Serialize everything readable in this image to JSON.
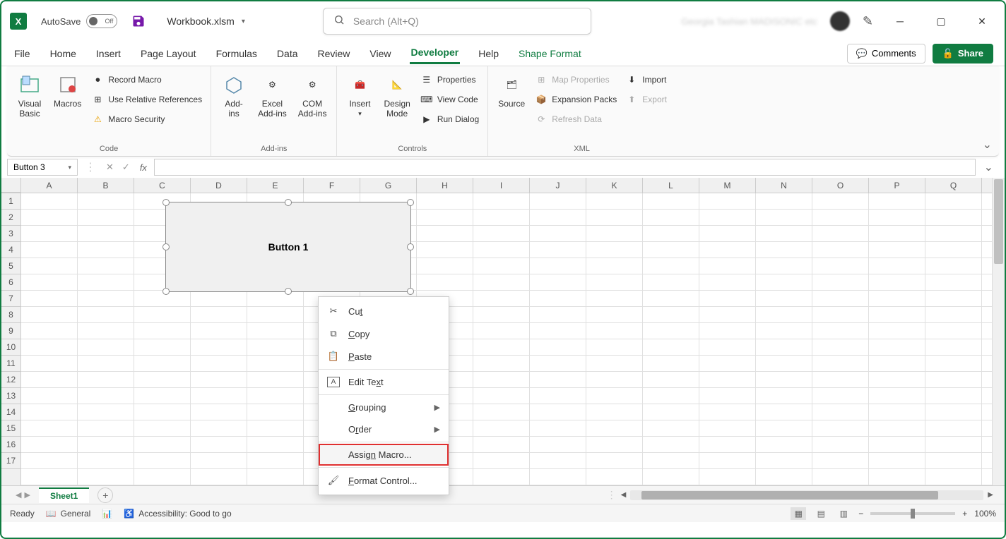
{
  "title": {
    "autosave": "AutoSave",
    "autosave_state": "Off",
    "filename": "Workbook.xlsm",
    "search_placeholder": "Search (Alt+Q)",
    "user_blurred": "Georgia Tashian MADISONIC etc"
  },
  "tabs": [
    "File",
    "Home",
    "Insert",
    "Page Layout",
    "Formulas",
    "Data",
    "Review",
    "View",
    "Developer",
    "Help",
    "Shape Format"
  ],
  "active_tab": "Developer",
  "tabs_right": {
    "comments": "Comments",
    "share": "Share"
  },
  "ribbon": {
    "code": {
      "label": "Code",
      "visual_basic": "Visual\nBasic",
      "macros": "Macros",
      "record_macro": "Record Macro",
      "use_relative": "Use Relative References",
      "macro_security": "Macro Security"
    },
    "addins": {
      "label": "Add-ins",
      "addins": "Add-\nins",
      "excel_addins": "Excel\nAdd-ins",
      "com_addins": "COM\nAdd-ins"
    },
    "controls": {
      "label": "Controls",
      "insert": "Insert",
      "design_mode": "Design\nMode",
      "properties": "Properties",
      "view_code": "View Code",
      "run_dialog": "Run Dialog"
    },
    "xml": {
      "label": "XML",
      "source": "Source",
      "map_properties": "Map Properties",
      "expansion_packs": "Expansion Packs",
      "refresh_data": "Refresh Data",
      "import": "Import",
      "export": "Export"
    }
  },
  "name_box": "Button 3",
  "columns": [
    "A",
    "B",
    "C",
    "D",
    "E",
    "F",
    "G",
    "H",
    "I",
    "J",
    "K",
    "L",
    "M",
    "N",
    "O",
    "P",
    "Q"
  ],
  "rows": [
    "1",
    "2",
    "3",
    "4",
    "5",
    "6",
    "7",
    "8",
    "9",
    "10",
    "11",
    "12",
    "13",
    "14",
    "15",
    "16",
    "17"
  ],
  "shape": {
    "label": "Button 1"
  },
  "context_menu": {
    "cut": "Cut",
    "copy": "Copy",
    "paste": "Paste",
    "edit_text": "Edit Text",
    "grouping": "Grouping",
    "order": "Order",
    "assign_macro": "Assign Macro...",
    "format_control": "Format Control..."
  },
  "sheet_tab": "Sheet1",
  "statusbar": {
    "ready": "Ready",
    "general": "General",
    "accessibility": "Accessibility: Good to go",
    "zoom": "100%"
  }
}
